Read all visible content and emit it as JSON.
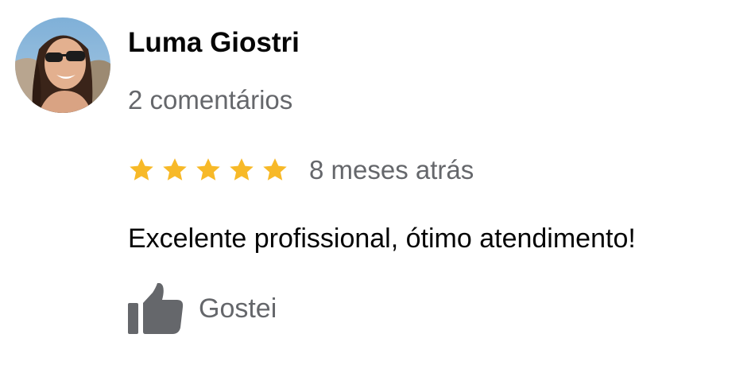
{
  "review": {
    "reviewer_name": "Luma Giostri",
    "review_count": "2 comentários",
    "rating": 5,
    "rating_max": 5,
    "time_ago": "8 meses atrás",
    "text": "Excelente profissional, ótimo atendimento!",
    "like_label": "Gostei"
  },
  "icons": {
    "star": "star-icon",
    "like": "thumbs-up-icon"
  },
  "colors": {
    "star": "#F7B928",
    "primary_text": "#050505",
    "secondary_text": "#65676B",
    "like_icon": "#65676B"
  }
}
